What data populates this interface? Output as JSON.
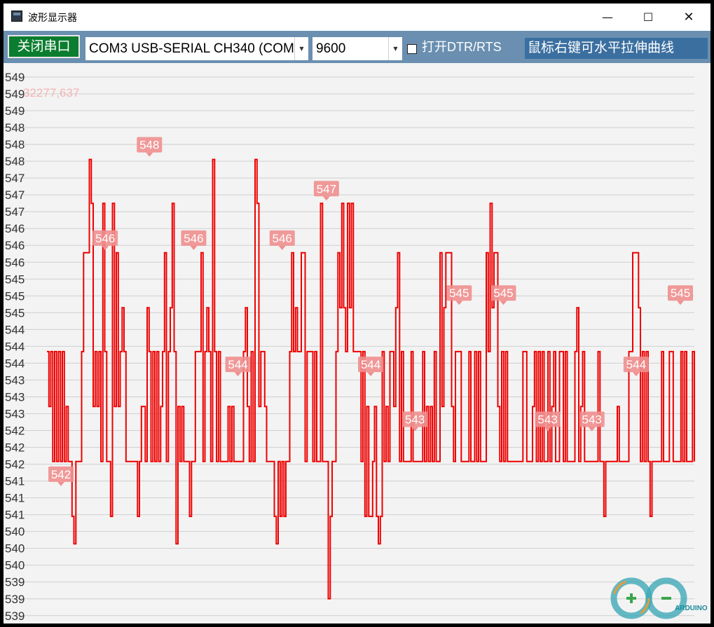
{
  "window": {
    "title": "波形显示器",
    "controls": {
      "minimize": "—",
      "maximize": "☐",
      "close": "✕"
    }
  },
  "toolbar": {
    "connect_label": "关闭串口",
    "port_value": "COM3 USB-SERIAL CH340 (COM",
    "baud_value": "9600",
    "dtr_label": "打开DTR/RTS",
    "dtr_checked": false,
    "hint": "鼠标右键可水平拉伸曲线"
  },
  "plot": {
    "cursor_readout": "32277,637",
    "line_color": "#ee0000",
    "label_color": "#f08f8f"
  },
  "logo": {
    "name": "arduino-cn-logo",
    "text": "ARDUINO"
  },
  "chart_data": {
    "type": "line",
    "title": "",
    "xlabel": "",
    "ylabel": "",
    "ylim": [
      539.6,
      549.5
    ],
    "y_tick_labels": [
      "549",
      "549",
      "549",
      "548",
      "548",
      "548",
      "547",
      "547",
      "547",
      "546",
      "546",
      "546",
      "545",
      "545",
      "545",
      "544",
      "544",
      "544",
      "543",
      "543",
      "543",
      "542",
      "542",
      "542",
      "541",
      "541",
      "541",
      "540",
      "540",
      "540",
      "539",
      "539",
      "539"
    ],
    "grid": true,
    "series": [
      {
        "values": [
          544.5,
          543.5,
          544.5,
          542.5,
          544.5,
          542.5,
          544.5,
          542.5,
          544.5,
          542.5,
          543.5,
          542.5,
          542.5,
          541.5,
          541.0,
          542.5,
          542.5,
          542.5,
          544.5,
          546.3,
          546.3,
          546.3,
          548.0,
          547.2,
          543.5,
          544.5,
          543.5,
          544.5,
          542.5,
          547.2,
          544.5,
          542.5,
          542.5,
          541.5,
          547.2,
          543.5,
          546.3,
          543.5,
          544.5,
          545.3,
          544.5,
          542.5,
          542.5,
          542.5,
          542.5,
          542.5,
          542.5,
          541.5,
          542.5,
          543.5,
          543.5,
          542.5,
          545.3,
          544.5,
          542.5,
          544.5,
          542.5,
          544.5,
          542.5,
          543.5,
          544.5,
          546.3,
          542.5,
          544.5,
          545.3,
          547.2,
          544.5,
          541.0,
          543.5,
          542.5,
          543.5,
          542.5,
          542.5,
          542.5,
          541.5,
          542.5,
          542.5,
          544.5,
          544.5,
          544.5,
          546.3,
          542.5,
          544.5,
          545.3,
          544.5,
          542.5,
          548.0,
          544.5,
          542.5,
          544.5,
          542.5,
          542.5,
          542.5,
          542.5,
          543.5,
          542.5,
          543.5,
          542.5,
          542.5,
          542.5,
          542.5,
          542.5,
          544.5,
          545.3,
          543.5,
          542.5,
          544.5,
          542.5,
          548.0,
          547.2,
          543.5,
          544.5,
          544.5,
          543.5,
          542.5,
          542.5,
          542.5,
          542.5,
          541.5,
          541.0,
          542.5,
          541.5,
          542.5,
          541.5,
          542.5,
          542.5,
          544.5,
          546.3,
          544.5,
          545.3,
          544.5,
          544.5,
          546.3,
          546.3,
          542.5,
          544.5,
          544.5,
          544.5,
          542.5,
          544.5,
          542.5,
          542.5,
          547.2,
          542.5,
          542.5,
          542.5,
          540.0,
          541.5,
          542.5,
          542.5,
          544.5,
          546.3,
          545.3,
          547.2,
          545.3,
          544.5,
          547.2,
          545.3,
          547.2,
          544.5,
          544.5,
          544.5,
          544.5,
          542.5,
          544.5,
          541.5,
          543.5,
          541.5,
          541.5,
          542.5,
          543.5,
          541.5,
          541.0,
          541.5,
          544.5,
          542.5,
          543.5,
          542.5,
          544.5,
          544.5,
          543.5,
          545.3,
          546.3,
          542.5,
          544.5,
          542.5,
          542.5,
          542.5,
          542.5,
          544.5,
          542.5,
          542.5,
          542.5,
          542.5,
          542.5,
          544.5,
          542.5,
          543.5,
          542.5,
          543.5,
          542.5,
          544.5,
          542.5,
          542.5,
          546.3,
          543.5,
          545.3,
          546.3,
          546.3,
          546.3,
          543.5,
          542.5,
          544.5,
          544.5,
          544.5,
          542.5,
          542.5,
          542.5,
          542.5,
          544.5,
          542.5,
          542.5,
          544.5,
          542.5,
          544.5,
          542.5,
          542.5,
          542.5,
          546.3,
          544.5,
          547.2,
          545.3,
          546.3,
          546.3,
          543.5,
          542.5,
          544.5,
          542.5,
          544.5,
          542.5,
          542.5,
          542.5,
          542.5,
          542.5,
          542.5,
          542.5,
          542.5,
          544.5,
          544.5,
          542.5,
          542.5,
          542.5,
          543.5,
          544.5,
          542.5,
          544.5,
          542.5,
          544.5,
          542.5,
          542.5,
          544.5,
          542.5,
          543.5,
          544.5,
          542.5,
          542.5,
          544.5,
          544.5,
          542.5,
          544.5,
          542.5,
          542.5,
          542.5,
          542.5,
          544.5,
          545.3,
          542.5,
          543.5,
          544.5,
          542.5,
          542.5,
          542.5,
          542.5,
          542.5,
          542.5,
          542.5,
          544.5,
          542.5,
          542.5,
          541.5,
          542.5,
          542.5,
          542.5,
          542.5,
          542.5,
          542.5,
          543.5,
          542.5,
          542.5,
          542.5,
          542.5,
          542.5,
          544.5,
          544.5,
          546.3,
          546.3,
          546.3,
          545.3,
          542.5,
          544.5,
          542.5,
          544.5,
          542.5,
          541.5,
          542.5,
          542.5,
          542.5,
          542.5,
          542.5,
          544.5,
          542.5,
          542.5,
          542.5,
          544.5,
          544.5,
          542.5,
          542.5,
          542.5,
          542.5,
          544.5,
          542.5,
          544.5,
          542.5,
          542.5,
          542.5,
          544.5,
          542.5
        ],
        "labels": [
          {
            "text": "542",
            "value": 542.0
          },
          {
            "text": "546",
            "value": 546.3
          },
          {
            "text": "548",
            "value": 548.0
          },
          {
            "text": "546",
            "value": 546.3
          },
          {
            "text": "544",
            "value": 544.0
          },
          {
            "text": "546",
            "value": 546.3
          },
          {
            "text": "547",
            "value": 547.2
          },
          {
            "text": "544",
            "value": 544.0
          },
          {
            "text": "543",
            "value": 543.0
          },
          {
            "text": "545",
            "value": 545.3
          },
          {
            "text": "545",
            "value": 545.3
          },
          {
            "text": "543",
            "value": 543.0
          },
          {
            "text": "543",
            "value": 543.0
          },
          {
            "text": "544",
            "value": 544.0
          },
          {
            "text": "545",
            "value": 545.3
          }
        ]
      }
    ]
  }
}
